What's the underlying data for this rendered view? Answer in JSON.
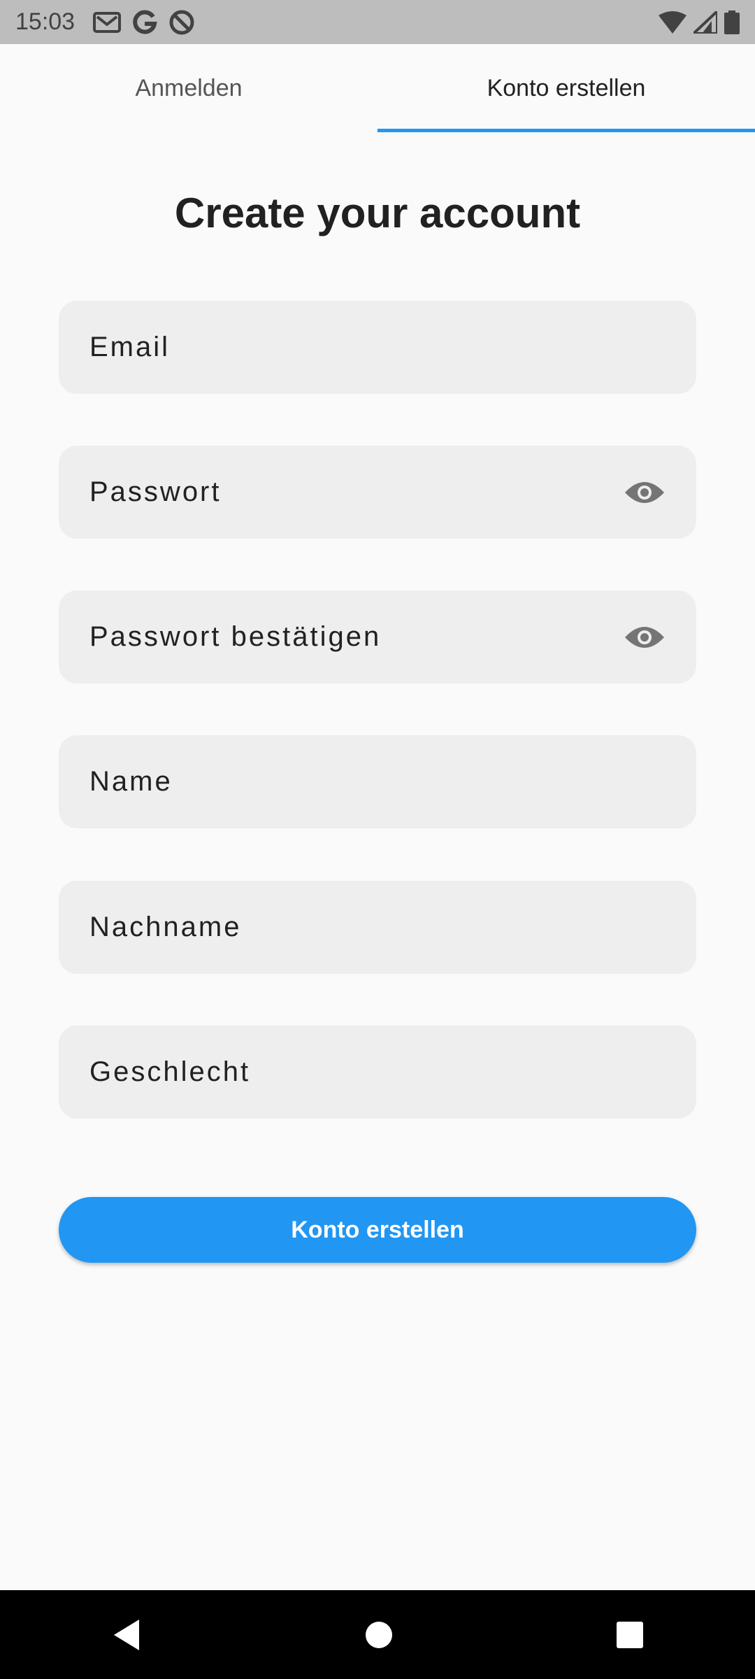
{
  "status_bar": {
    "time": "15:03",
    "left_icons": [
      "gmail-icon",
      "google-icon",
      "do-not-disturb-icon"
    ],
    "right_icons": [
      "wifi-icon",
      "cell-signal-icon",
      "battery-icon"
    ]
  },
  "tabs": [
    {
      "label": "Anmelden",
      "active": false
    },
    {
      "label": "Konto erstellen",
      "active": true
    }
  ],
  "accent_color": "#2196f3",
  "form": {
    "title": "Create your account",
    "fields": [
      {
        "placeholder": "Email"
      },
      {
        "placeholder": "Passwort",
        "icon": "eye-icon"
      },
      {
        "placeholder": "Passwort bestätigen",
        "icon": "eye-icon"
      },
      {
        "placeholder": "Name"
      },
      {
        "placeholder": "Nachname"
      },
      {
        "placeholder": "Geschlecht"
      }
    ],
    "submit_label": "Konto erstellen"
  },
  "nav_bar": {
    "buttons": [
      "back-icon",
      "home-icon",
      "recents-icon"
    ]
  }
}
